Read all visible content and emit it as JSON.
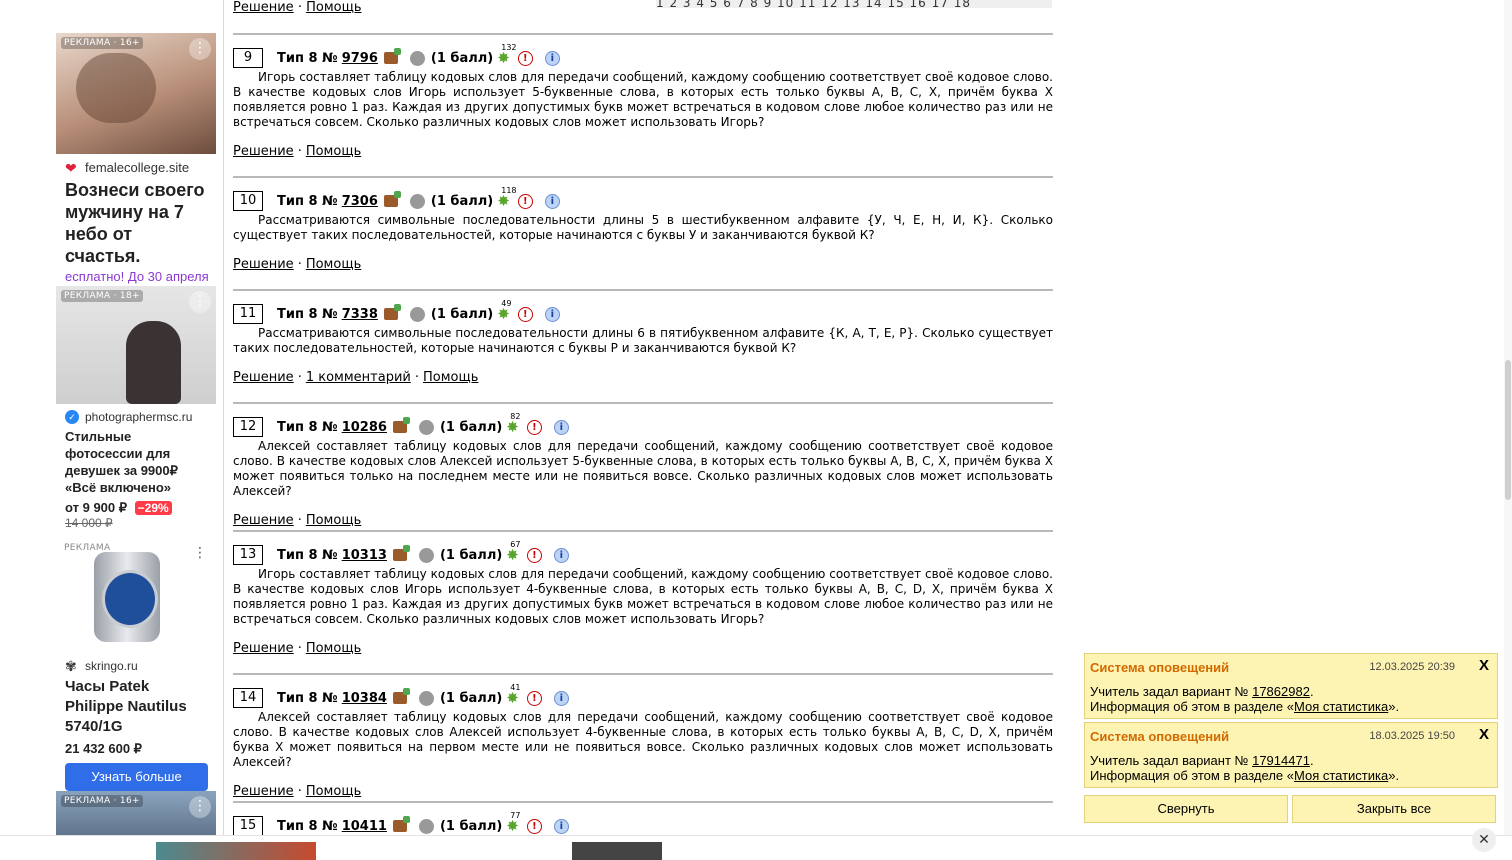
{
  "pager": {
    "pages": "1 2 3 4 5 6 7 8 9 10 11 12 13 14 15 16 17 18"
  },
  "top_links": {
    "solution": "Решение",
    "help": "Помощь"
  },
  "tasks": [
    {
      "num": "9",
      "type": "Тип 8 №",
      "id": "9796",
      "points": "(1 балл)",
      "badge": "132",
      "text": "Игорь составляет таблицу кодовых слов для передачи сообщений, каждому сообщению соответствует своё кодовое слово. В качестве кодовых слов Игорь использует 5-буквенные слова, в которых есть только буквы A, B, C, X, причём буква X появляется ровно 1 раз. Каждая из других допустимых букв может встречаться в кодовом слове любое количество раз или не встречаться совсем. Сколько различных кодовых слов может использовать Игорь?",
      "solution": "Решение",
      "comments": "",
      "help": "Помощь"
    },
    {
      "num": "10",
      "type": "Тип 8 №",
      "id": "7306",
      "points": "(1 балл)",
      "badge": "118",
      "text": "Рассматриваются символьные последовательности длины 5 в шестибуквенном алфавите {У, Ч, Е, Н, И, К}. Сколько существует таких последовательностей, которые начинаются с буквы У и заканчиваются буквой К?",
      "solution": "Решение",
      "comments": "",
      "help": "Помощь"
    },
    {
      "num": "11",
      "type": "Тип 8 №",
      "id": "7338",
      "points": "(1 балл)",
      "badge": "49",
      "text": "Рассматриваются символьные последовательности длины 6 в пятибуквенном алфавите {К, А, Т, Е, Р}. Сколько существует таких последовательностей, которые начинаются с буквы Р и заканчиваются буквой К?",
      "solution": "Решение",
      "comments": "1 комментарий",
      "help": "Помощь"
    },
    {
      "num": "12",
      "type": "Тип 8 №",
      "id": "10286",
      "points": "(1 балл)",
      "badge": "82",
      "text": "Алексей составляет таблицу кодовых слов для передачи сообщений, каждому сообщению соответствует своё кодовое слово. В качестве кодовых слов Алексей использует 5-буквенные слова, в которых есть только буквы A, B, C, X, причём буква X может появиться только на последнем месте или не появиться вовсе. Сколько различных кодовых слов может использовать Алексей?",
      "solution": "Решение",
      "comments": "",
      "help": "Помощь"
    },
    {
      "num": "13",
      "type": "Тип 8 №",
      "id": "10313",
      "points": "(1 балл)",
      "badge": "67",
      "text": "Игорь составляет таблицу кодовых слов для передачи сообщений, каждому сообщению соответствует своё кодовое слово. В качестве кодовых слов Игорь использует 4-буквенные слова, в которых есть только буквы A, B, C, D, X, причём буква X появляется ровно 1 раз. Каждая из других допустимых букв может встречаться в кодовом слове любое количество раз или не встречаться совсем. Сколько различных кодовых слов может использовать Игорь?",
      "solution": "Решение",
      "comments": "",
      "help": "Помощь"
    },
    {
      "num": "14",
      "type": "Тип 8 №",
      "id": "10384",
      "points": "(1 балл)",
      "badge": "41",
      "text": "Алексей составляет таблицу кодовых слов для передачи сообщений, каждому сообщению соответствует своё кодовое слово. В качестве кодовых слов Алексей использует 4-буквенные слова, в которых есть только буквы A, B, C, D, X, причём буква X может появиться на первом месте или не появиться вовсе. Сколько различных кодовых слов может использовать Алексей?",
      "solution": "Решение",
      "comments": "",
      "help": "Помощь"
    },
    {
      "num": "15",
      "type": "Тип 8 №",
      "id": "10411",
      "points": "(1 балл)",
      "badge": "77",
      "text": "",
      "solution": "",
      "comments": "",
      "help": ""
    }
  ],
  "ads": [
    {
      "label": "РЕКЛАМА · 16+",
      "site": "femalecollege.site",
      "headline": "Вознеси своего мужчину на 7 небо от счастья.",
      "note": "есплатно! До 30 апреля"
    },
    {
      "label": "РЕКЛАМА · 18+",
      "site": "photographermsc.ru",
      "headline": "Стильные фотосессии для девушек за 9900₽ «Всё включено»",
      "price": "от 9 900 ₽",
      "discount": "−29%",
      "old_price": "14 000 ₽"
    },
    {
      "label": "РЕКЛАМА",
      "site": "skringo.ru",
      "headline": "Часы Patek Philippe Nautilus 5740/1G",
      "price": "21 432 600 ₽",
      "button": "Узнать больше"
    },
    {
      "label": "РЕКЛАМА · 16+"
    }
  ],
  "notifications": [
    {
      "title": "Система оповещений",
      "date": "12.03.2025 20:39",
      "line1_pre": "Учитель задал вариант № ",
      "variant": "17862982",
      "line1_post": ".",
      "line2_pre": "Информация об этом в разделе «",
      "link": "Моя статистика",
      "line2_post": "»."
    },
    {
      "title": "Система оповещений",
      "date": "18.03.2025 19:50",
      "line1_pre": "Учитель задал вариант № ",
      "variant": "17914471",
      "line1_post": ".",
      "line2_pre": "Информация об этом в разделе «",
      "link": "Моя статистика",
      "line2_post": "»."
    }
  ],
  "notif_buttons": {
    "collapse": "Свернуть",
    "close_all": "Закрыть все"
  },
  "bottom_bar": {
    "close": "✕"
  }
}
